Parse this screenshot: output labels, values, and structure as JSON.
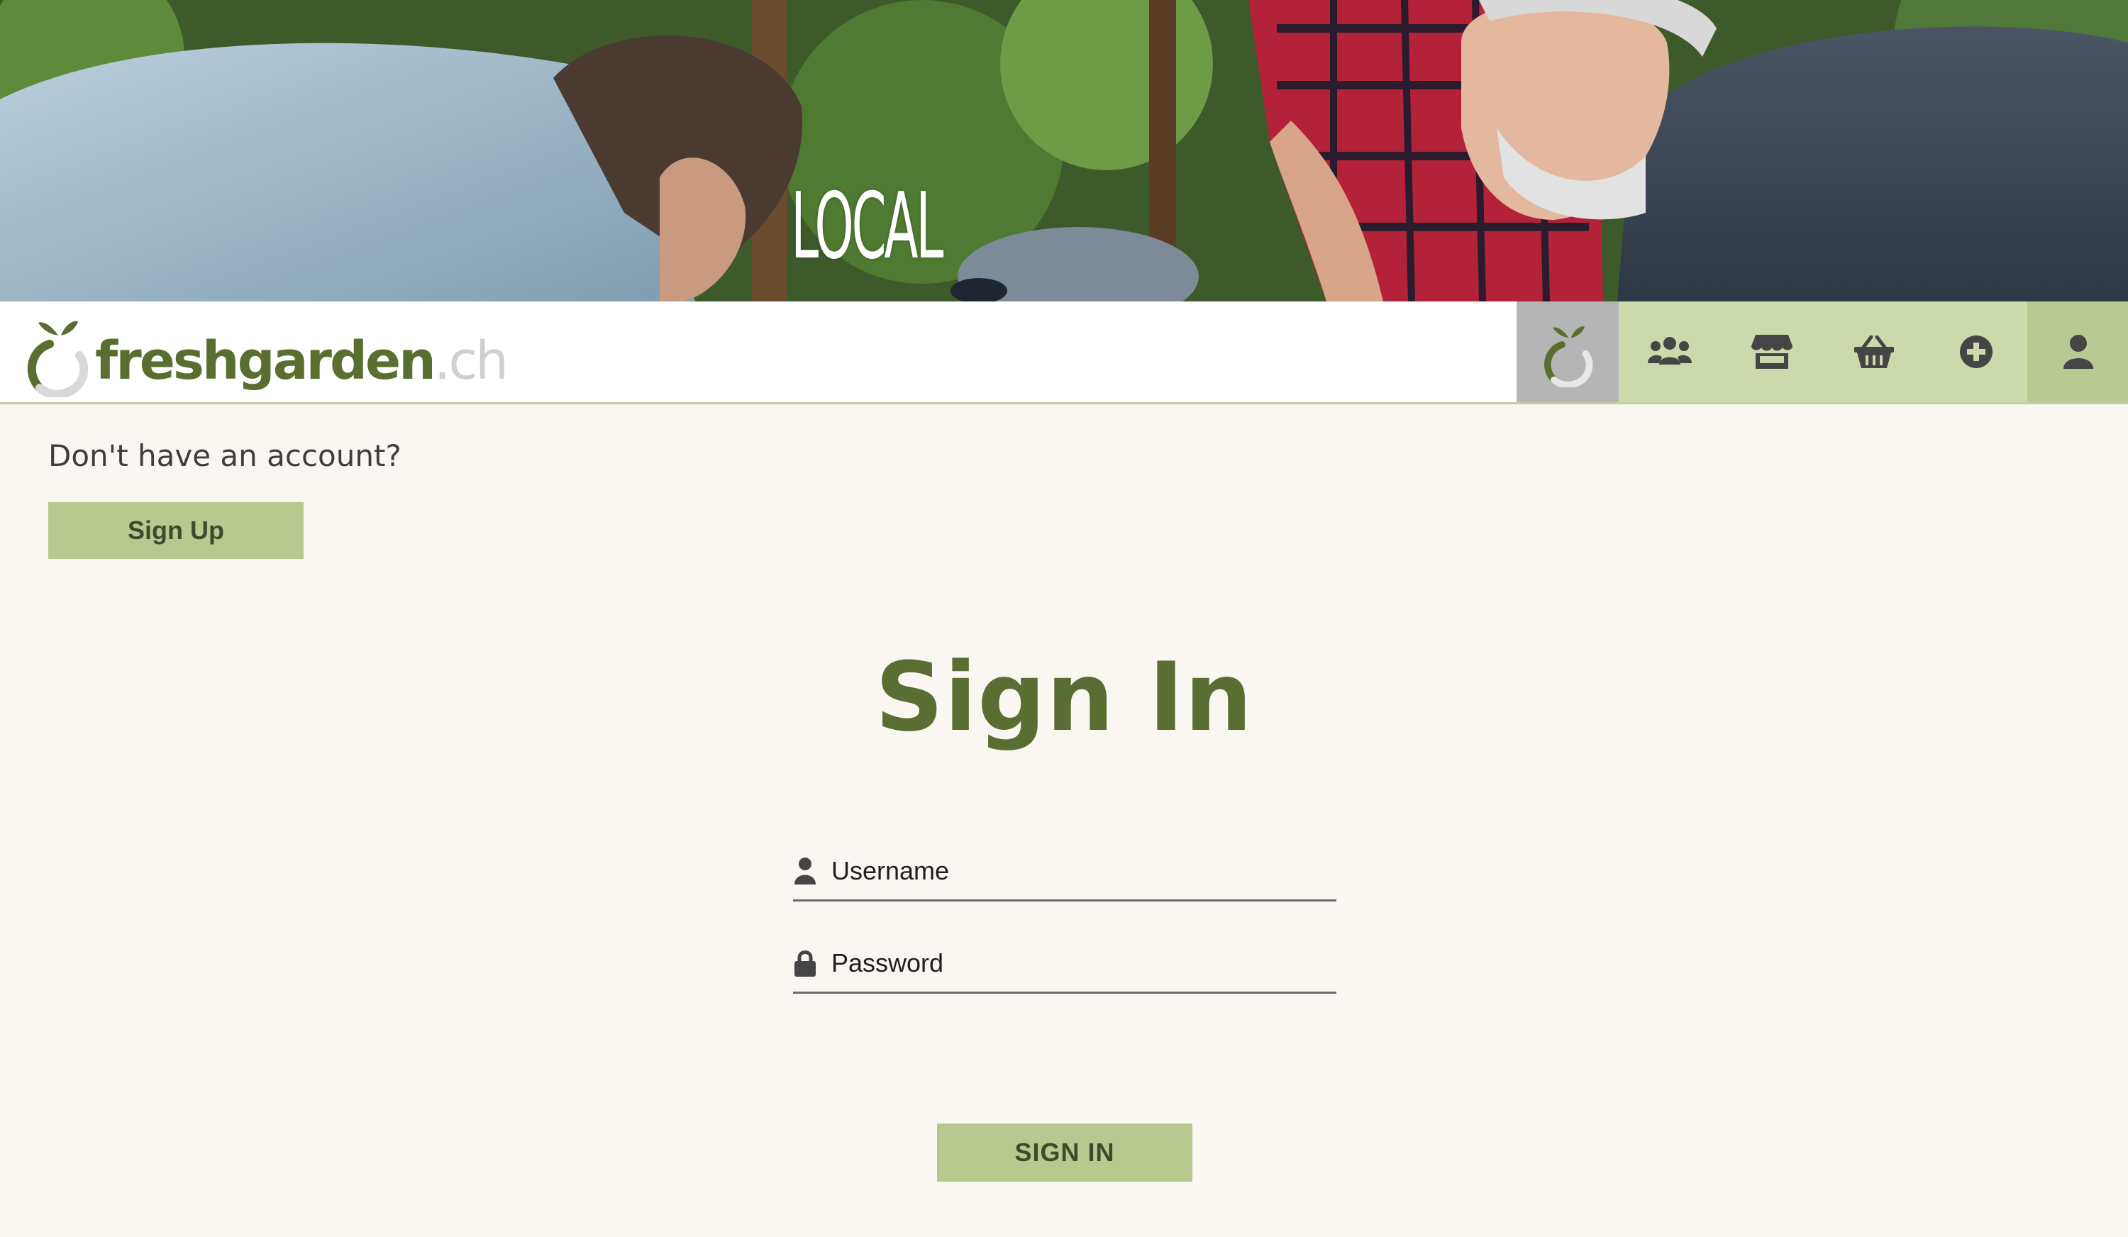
{
  "hero": {
    "overlay_text": "LOCAL"
  },
  "header": {
    "logo": {
      "name": "freshgarden",
      "tld": ".ch"
    },
    "nav": [
      {
        "icon": "apple-logo-icon",
        "label": "home"
      },
      {
        "icon": "users-icon",
        "label": "community"
      },
      {
        "icon": "store-icon",
        "label": "shop"
      },
      {
        "icon": "basket-icon",
        "label": "basket"
      },
      {
        "icon": "plus-circle-icon",
        "label": "add"
      },
      {
        "icon": "user-icon",
        "label": "account"
      }
    ]
  },
  "signup": {
    "prompt": "Don't have an account?",
    "button_label": "Sign Up"
  },
  "signin": {
    "title": "Sign In",
    "username_placeholder": "Username",
    "password_placeholder": "Password",
    "button_label": "SIGN IN"
  },
  "colors": {
    "brand_green": "#5a6e2f",
    "button_green": "#b8c990",
    "nav_green": "#cbd9ad",
    "page_bg": "#faf7f3"
  }
}
